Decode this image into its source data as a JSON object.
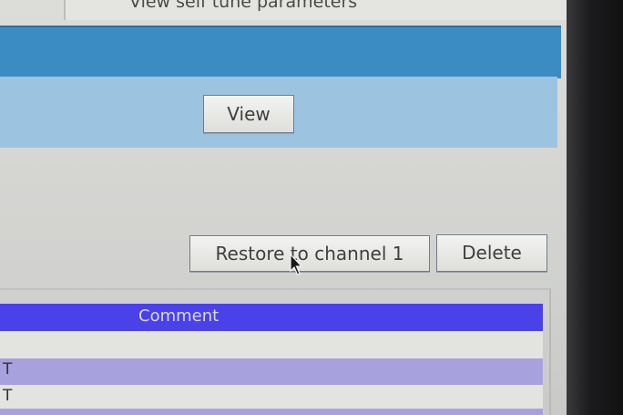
{
  "window": {
    "title": "View self tune parameters"
  },
  "buttons": {
    "view": "View",
    "restore": "Restore to channel 1",
    "delete": "Delete"
  },
  "table": {
    "header": "Comment",
    "rows": [
      {
        "cell": "T"
      },
      {
        "cell": "T"
      }
    ]
  },
  "icons": {
    "cursor": "arrow-pointer-icon"
  },
  "colors": {
    "title_band": "#3c8cc4",
    "subpanel": "#9cc4e1",
    "table_header": "#4a42e8",
    "row_highlight": "#a7a2dd"
  }
}
